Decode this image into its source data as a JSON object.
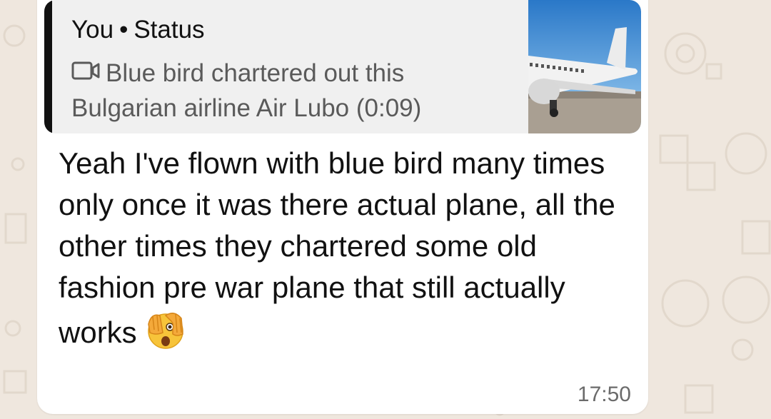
{
  "quote": {
    "sender": "You",
    "separator": "•",
    "kind": "Status",
    "icon": "video-camera-icon",
    "text": "Blue bird chartered  out this Bulgarian airline Air Lubo (0:09)",
    "thumbnail": "airplane-thumbnail"
  },
  "message": {
    "text": "Yeah I've flown with blue bird many times only once it was there actual plane, all the other times they chartered some old fashion pre war plane that still actually works",
    "emoji": "face-with-peeking-eye-emoji",
    "time": "17:50"
  },
  "colors": {
    "bubble": "#ffffff",
    "quote_bg": "#f0f0f0",
    "quote_bar": "#111111",
    "chat_bg": "#efe7de"
  }
}
